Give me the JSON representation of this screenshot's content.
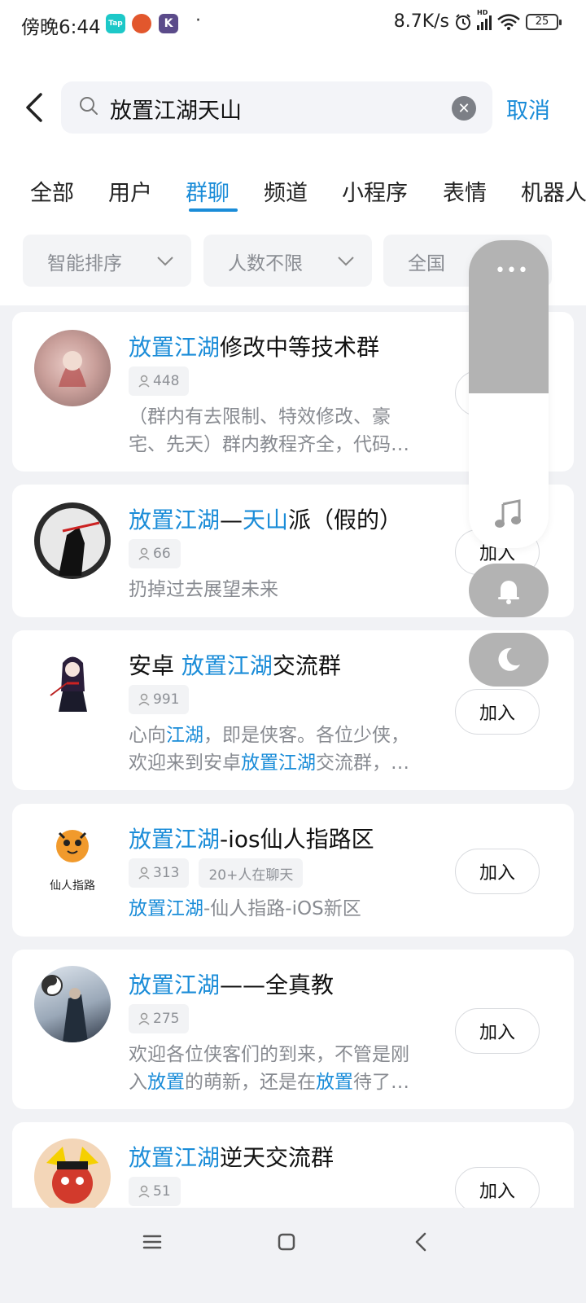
{
  "status_bar": {
    "time": "傍晚6:44",
    "apps": [
      {
        "name": "taptap-icon",
        "text": "Tap",
        "color": "#1dc8c8"
      },
      {
        "name": "game-icon",
        "text": "",
        "color": "#e2572d"
      },
      {
        "name": "kuaishou-icon",
        "text": "K",
        "color": "#5b4b8a"
      }
    ],
    "dot": "·",
    "net_speed": "8.7K/s",
    "hd": "HD",
    "battery": "25"
  },
  "search": {
    "query": "放置江湖天山",
    "cancel_label": "取消"
  },
  "tabs": [
    {
      "label": "全部"
    },
    {
      "label": "用户"
    },
    {
      "label": "群聊",
      "active": true
    },
    {
      "label": "频道"
    },
    {
      "label": "小程序"
    },
    {
      "label": "表情"
    },
    {
      "label": "机器人"
    }
  ],
  "filters": [
    {
      "label": "智能排序"
    },
    {
      "label": "人数不限"
    },
    {
      "label": "全国"
    }
  ],
  "results": [
    {
      "title_parts": [
        {
          "t": "放置江湖",
          "hl": true
        },
        {
          "t": "修改中等技术群"
        }
      ],
      "members": "448",
      "desc_lines": [
        [
          {
            "t": "（群内有去限制、特效修改、豪"
          }
        ],
        [
          {
            "t": "宅、先天）群内教程齐全，代码…"
          }
        ]
      ],
      "join_label": "加入"
    },
    {
      "title_parts": [
        {
          "t": "放置江湖",
          "hl": true
        },
        {
          "t": "—"
        },
        {
          "t": "天山",
          "hl": true
        },
        {
          "t": "派（假的）"
        }
      ],
      "members": "66",
      "desc_lines": [
        [
          {
            "t": "扔掉过去展望未来"
          }
        ]
      ],
      "join_label": "加入"
    },
    {
      "title_parts": [
        {
          "t": "安卓 "
        },
        {
          "t": "放置江湖",
          "hl": true
        },
        {
          "t": "交流群"
        }
      ],
      "members": "991",
      "desc_lines": [
        [
          {
            "t": "心向"
          },
          {
            "t": "江湖",
            "hl": true
          },
          {
            "t": "，即是侠客。各位少侠，"
          }
        ],
        [
          {
            "t": "欢迎来到安卓"
          },
          {
            "t": "放置江湖",
            "hl": true
          },
          {
            "t": "交流群，…"
          }
        ]
      ],
      "join_label": "加入"
    },
    {
      "title_parts": [
        {
          "t": "放置江湖",
          "hl": true
        },
        {
          "t": "-ios仙人指路区"
        }
      ],
      "members": "313",
      "extra_badge": "20+人在聊天",
      "avatar_text": "仙人指路",
      "desc_lines": [
        [
          {
            "t": "放置江湖",
            "hl": true
          },
          {
            "t": "-仙人指路-iOS新区"
          }
        ]
      ],
      "join_label": "加入"
    },
    {
      "title_parts": [
        {
          "t": "放置江湖",
          "hl": true
        },
        {
          "t": "——全真教"
        }
      ],
      "members": "275",
      "desc_lines": [
        [
          {
            "t": "欢迎各位侠客们的到来，不管是刚"
          }
        ],
        [
          {
            "t": "入"
          },
          {
            "t": "放置",
            "hl": true
          },
          {
            "t": "的萌新，还是在"
          },
          {
            "t": "放置",
            "hl": true
          },
          {
            "t": "待了…"
          }
        ]
      ],
      "join_label": "加入"
    },
    {
      "title_parts": [
        {
          "t": "放置江湖",
          "hl": true
        },
        {
          "t": "逆天交流群"
        }
      ],
      "members": "51",
      "desc_lines": [],
      "join_label": "加入"
    }
  ],
  "float_panel": {
    "dots": "•••",
    "icons": [
      "music-note-icon",
      "bell-icon",
      "moon-icon"
    ]
  }
}
